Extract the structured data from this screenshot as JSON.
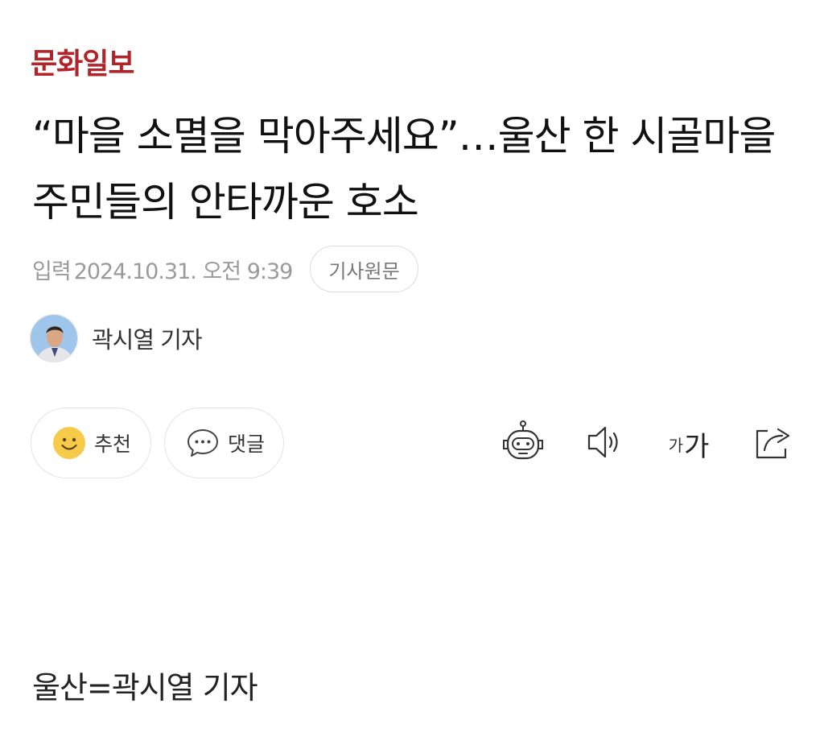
{
  "publisher": {
    "name": "문화일보",
    "color": "#b3232a"
  },
  "article": {
    "headline": "“마을 소멸을 막아주세요”…울산 한 시골마을 주민들의 안타까운 호소",
    "meta": {
      "label": "입력",
      "date": "2024.10.31. 오전 9:39",
      "original_button": "기사원문"
    },
    "reporter": {
      "name": "곽시열 기자"
    },
    "actions": {
      "recommend": "추천",
      "comment": "댓글"
    },
    "tools": {
      "ai_icon": "robot-icon",
      "audio_icon": "speaker-icon",
      "font_small": "가",
      "font_large": "가",
      "share_icon": "share-icon"
    },
    "body_first_line": "울산=곽시열 기자"
  }
}
